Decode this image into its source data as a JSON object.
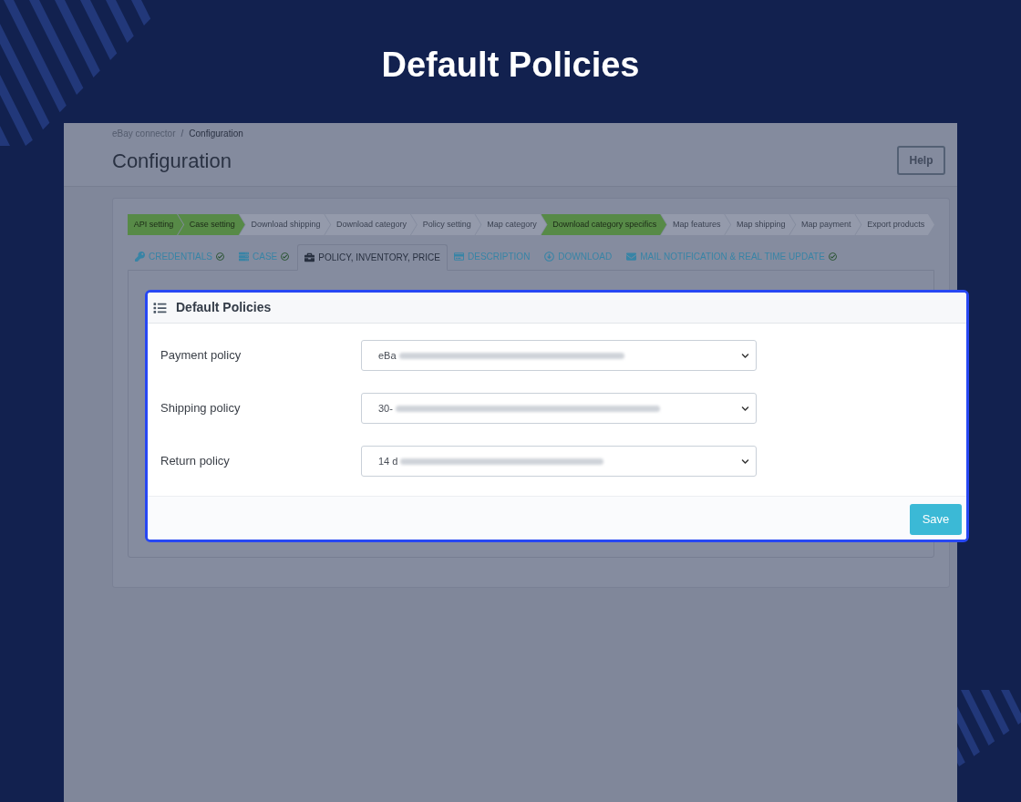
{
  "heading": "Default Policies",
  "breadcrumb": {
    "items": [
      {
        "label": "eBay connector",
        "current": false
      },
      {
        "label": "Configuration",
        "current": true
      }
    ],
    "separator": "/"
  },
  "page_title": "Configuration",
  "help_button": "Help",
  "steps": [
    {
      "label": "API setting",
      "done": true
    },
    {
      "label": "Case setting",
      "done": true
    },
    {
      "label": "Download shipping",
      "done": false
    },
    {
      "label": "Download category",
      "done": false
    },
    {
      "label": "Policy setting",
      "done": false
    },
    {
      "label": "Map category",
      "done": false
    },
    {
      "label": "Download category specifics",
      "done": true
    },
    {
      "label": "Map features",
      "done": false
    },
    {
      "label": "Map shipping",
      "done": false
    },
    {
      "label": "Map payment",
      "done": false
    },
    {
      "label": "Export products",
      "done": false
    }
  ],
  "tabs": [
    {
      "label": "CREDENTIALS",
      "selected": false,
      "complete": true
    },
    {
      "label": "CASE",
      "selected": false,
      "complete": true
    },
    {
      "label": "POLICY, INVENTORY, PRICE",
      "selected": true,
      "complete": false
    },
    {
      "label": "DESCRIPTION",
      "selected": false,
      "complete": false
    },
    {
      "label": "DOWNLOAD",
      "selected": false,
      "complete": false
    },
    {
      "label": "MAIL NOTIFICATION & REAL TIME UPDATE",
      "selected": false,
      "complete": true
    }
  ],
  "policies_card": {
    "title": "Default Policies",
    "fields": [
      {
        "label": "Payment policy",
        "value": "eBa"
      },
      {
        "label": "Shipping policy",
        "value": "30-"
      },
      {
        "label": "Return policy",
        "value": "14 d"
      }
    ],
    "save_button": "Save"
  }
}
